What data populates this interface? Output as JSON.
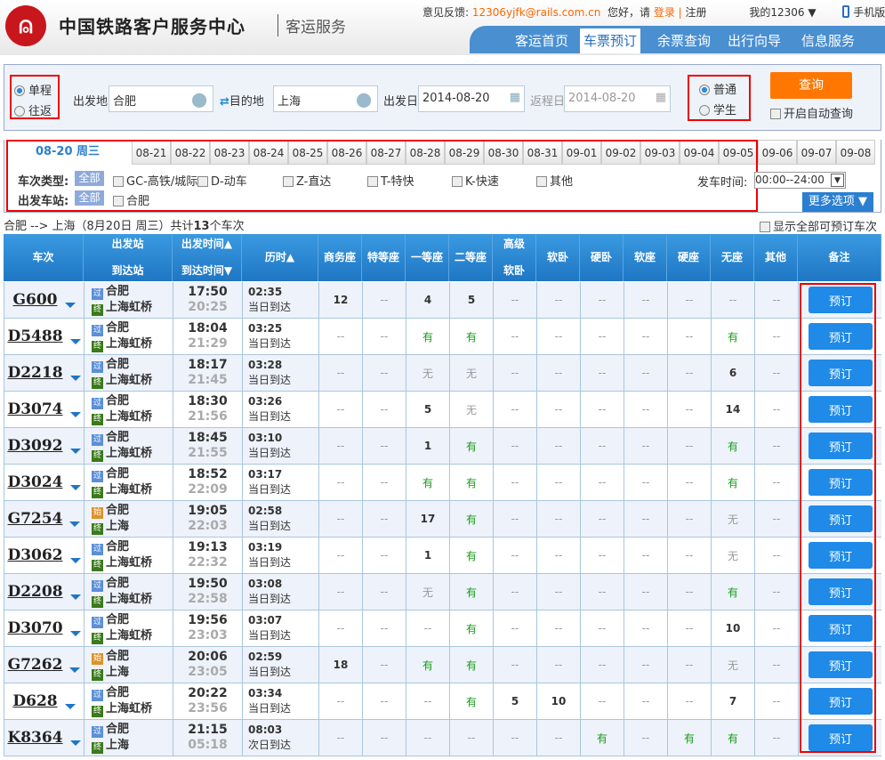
{
  "header": {
    "brand": "中国铁路客户服务中心",
    "sub": "客运服务",
    "feedback_label": "意见反馈:",
    "feedback_email": "12306yjfk@rails.com.cn",
    "greeting": "您好，请",
    "login": "登录",
    "sep": "|",
    "register": "注册",
    "my12306": "我的12306",
    "mobile": "手机版",
    "nav": [
      "客运首页",
      "车票预订",
      "余票查询",
      "出行向导",
      "信息服务"
    ],
    "nav_active": 1
  },
  "query": {
    "one_way": "单程",
    "round_trip": "往返",
    "from_label": "出发地",
    "from": "合肥",
    "to_label": "目的地",
    "to": "上海",
    "date_label": "出发日",
    "date": "2014-08-20",
    "return_label": "返程日",
    "return_date": "2014-08-20",
    "adult": "普通",
    "student": "学生",
    "search": "查询",
    "auto": "开启自动查询"
  },
  "dates": {
    "active": "08-20 周三",
    "tabs": [
      "08-21",
      "08-22",
      "08-23",
      "08-24",
      "08-25",
      "08-26",
      "08-27",
      "08-28",
      "08-29",
      "08-30",
      "08-31",
      "09-01",
      "09-02",
      "09-03",
      "09-04",
      "09-05",
      "09-06",
      "09-07",
      "09-08"
    ]
  },
  "filters": {
    "type_label": "车次类型:",
    "all": "全部",
    "types": [
      "GC-高铁/城际",
      "D-动车",
      "Z-直达",
      "T-特快",
      "K-快速",
      "其他"
    ],
    "station_label": "出发车站:",
    "stations": [
      "合肥"
    ],
    "time_label": "发车时间:",
    "time_value": "00:00--24:00",
    "more": "更多选项 ▼"
  },
  "caption": {
    "route": "合肥 --> 上海（8月20日  周三）共计",
    "count": "13",
    "suffix": "个车次",
    "show_all": "显示全部可预订车次"
  },
  "table": {
    "headers": [
      "车次",
      "出发站\n到达站",
      "出发时间▲\n到达时间▼",
      "历时▲",
      "商务座",
      "特等座",
      "一等座",
      "二等座",
      "高级\n软卧",
      "软卧",
      "硬卧",
      "软座",
      "硬座",
      "无座",
      "其他",
      "备注"
    ],
    "book_label": "预订",
    "rows": [
      {
        "no": "G600",
        "from": "合肥",
        "from_type": "过",
        "to": "上海虹桥",
        "dep": "17:50",
        "arr": "20:25",
        "dur": "02:35",
        "day": "当日到达",
        "seats": [
          "12",
          "--",
          "4",
          "5",
          "--",
          "--",
          "--",
          "--",
          "--",
          "--",
          "--"
        ]
      },
      {
        "no": "D5488",
        "from": "合肥",
        "from_type": "过",
        "to": "上海虹桥",
        "dep": "18:04",
        "arr": "21:29",
        "dur": "03:25",
        "day": "当日到达",
        "seats": [
          "--",
          "--",
          "有",
          "有",
          "--",
          "--",
          "--",
          "--",
          "--",
          "有",
          "--"
        ]
      },
      {
        "no": "D2218",
        "from": "合肥",
        "from_type": "过",
        "to": "上海虹桥",
        "dep": "18:17",
        "arr": "21:45",
        "dur": "03:28",
        "day": "当日到达",
        "seats": [
          "--",
          "--",
          "无",
          "无",
          "--",
          "--",
          "--",
          "--",
          "--",
          "6",
          "--"
        ]
      },
      {
        "no": "D3074",
        "from": "合肥",
        "from_type": "过",
        "to": "上海虹桥",
        "dep": "18:30",
        "arr": "21:56",
        "dur": "03:26",
        "day": "当日到达",
        "seats": [
          "--",
          "--",
          "5",
          "无",
          "--",
          "--",
          "--",
          "--",
          "--",
          "14",
          "--"
        ]
      },
      {
        "no": "D3092",
        "from": "合肥",
        "from_type": "过",
        "to": "上海虹桥",
        "dep": "18:45",
        "arr": "21:55",
        "dur": "03:10",
        "day": "当日到达",
        "seats": [
          "--",
          "--",
          "1",
          "有",
          "--",
          "--",
          "--",
          "--",
          "--",
          "有",
          "--"
        ]
      },
      {
        "no": "D3024",
        "from": "合肥",
        "from_type": "过",
        "to": "上海虹桥",
        "dep": "18:52",
        "arr": "22:09",
        "dur": "03:17",
        "day": "当日到达",
        "seats": [
          "--",
          "--",
          "有",
          "有",
          "--",
          "--",
          "--",
          "--",
          "--",
          "有",
          "--"
        ]
      },
      {
        "no": "G7254",
        "from": "合肥",
        "from_type": "始",
        "to": "上海",
        "dep": "19:05",
        "arr": "22:03",
        "dur": "02:58",
        "day": "当日到达",
        "seats": [
          "--",
          "--",
          "17",
          "有",
          "--",
          "--",
          "--",
          "--",
          "--",
          "无",
          "--"
        ]
      },
      {
        "no": "D3062",
        "from": "合肥",
        "from_type": "过",
        "to": "上海虹桥",
        "dep": "19:13",
        "arr": "22:32",
        "dur": "03:19",
        "day": "当日到达",
        "seats": [
          "--",
          "--",
          "1",
          "有",
          "--",
          "--",
          "--",
          "--",
          "--",
          "无",
          "--"
        ]
      },
      {
        "no": "D2208",
        "from": "合肥",
        "from_type": "过",
        "to": "上海虹桥",
        "dep": "19:50",
        "arr": "22:58",
        "dur": "03:08",
        "day": "当日到达",
        "seats": [
          "--",
          "--",
          "无",
          "有",
          "--",
          "--",
          "--",
          "--",
          "--",
          "有",
          "--"
        ]
      },
      {
        "no": "D3070",
        "from": "合肥",
        "from_type": "过",
        "to": "上海虹桥",
        "dep": "19:56",
        "arr": "23:03",
        "dur": "03:07",
        "day": "当日到达",
        "seats": [
          "--",
          "--",
          "--",
          "有",
          "--",
          "--",
          "--",
          "--",
          "--",
          "10",
          "--"
        ]
      },
      {
        "no": "G7262",
        "from": "合肥",
        "from_type": "始",
        "to": "上海",
        "dep": "20:06",
        "arr": "23:05",
        "dur": "02:59",
        "day": "当日到达",
        "seats": [
          "18",
          "--",
          "有",
          "有",
          "--",
          "--",
          "--",
          "--",
          "--",
          "无",
          "--"
        ]
      },
      {
        "no": "D628",
        "from": "合肥",
        "from_type": "过",
        "to": "上海虹桥",
        "dep": "20:22",
        "arr": "23:56",
        "dur": "03:34",
        "day": "当日到达",
        "seats": [
          "--",
          "--",
          "--",
          "有",
          "5",
          "10",
          "--",
          "--",
          "--",
          "7",
          "--"
        ]
      },
      {
        "no": "K8364",
        "from": "合肥",
        "from_type": "过",
        "to": "上海",
        "dep": "21:15",
        "arr": "05:18",
        "dur": "08:03",
        "day": "次日到达",
        "seats": [
          "--",
          "--",
          "--",
          "--",
          "--",
          "--",
          "有",
          "--",
          "有",
          "有",
          "--"
        ]
      }
    ],
    "arrive_type": "终"
  },
  "colors": {
    "accent": "#1f76c4",
    "orange": "#ff7700",
    "highlight": "#ee0000",
    "available": "#1a9c1a"
  }
}
